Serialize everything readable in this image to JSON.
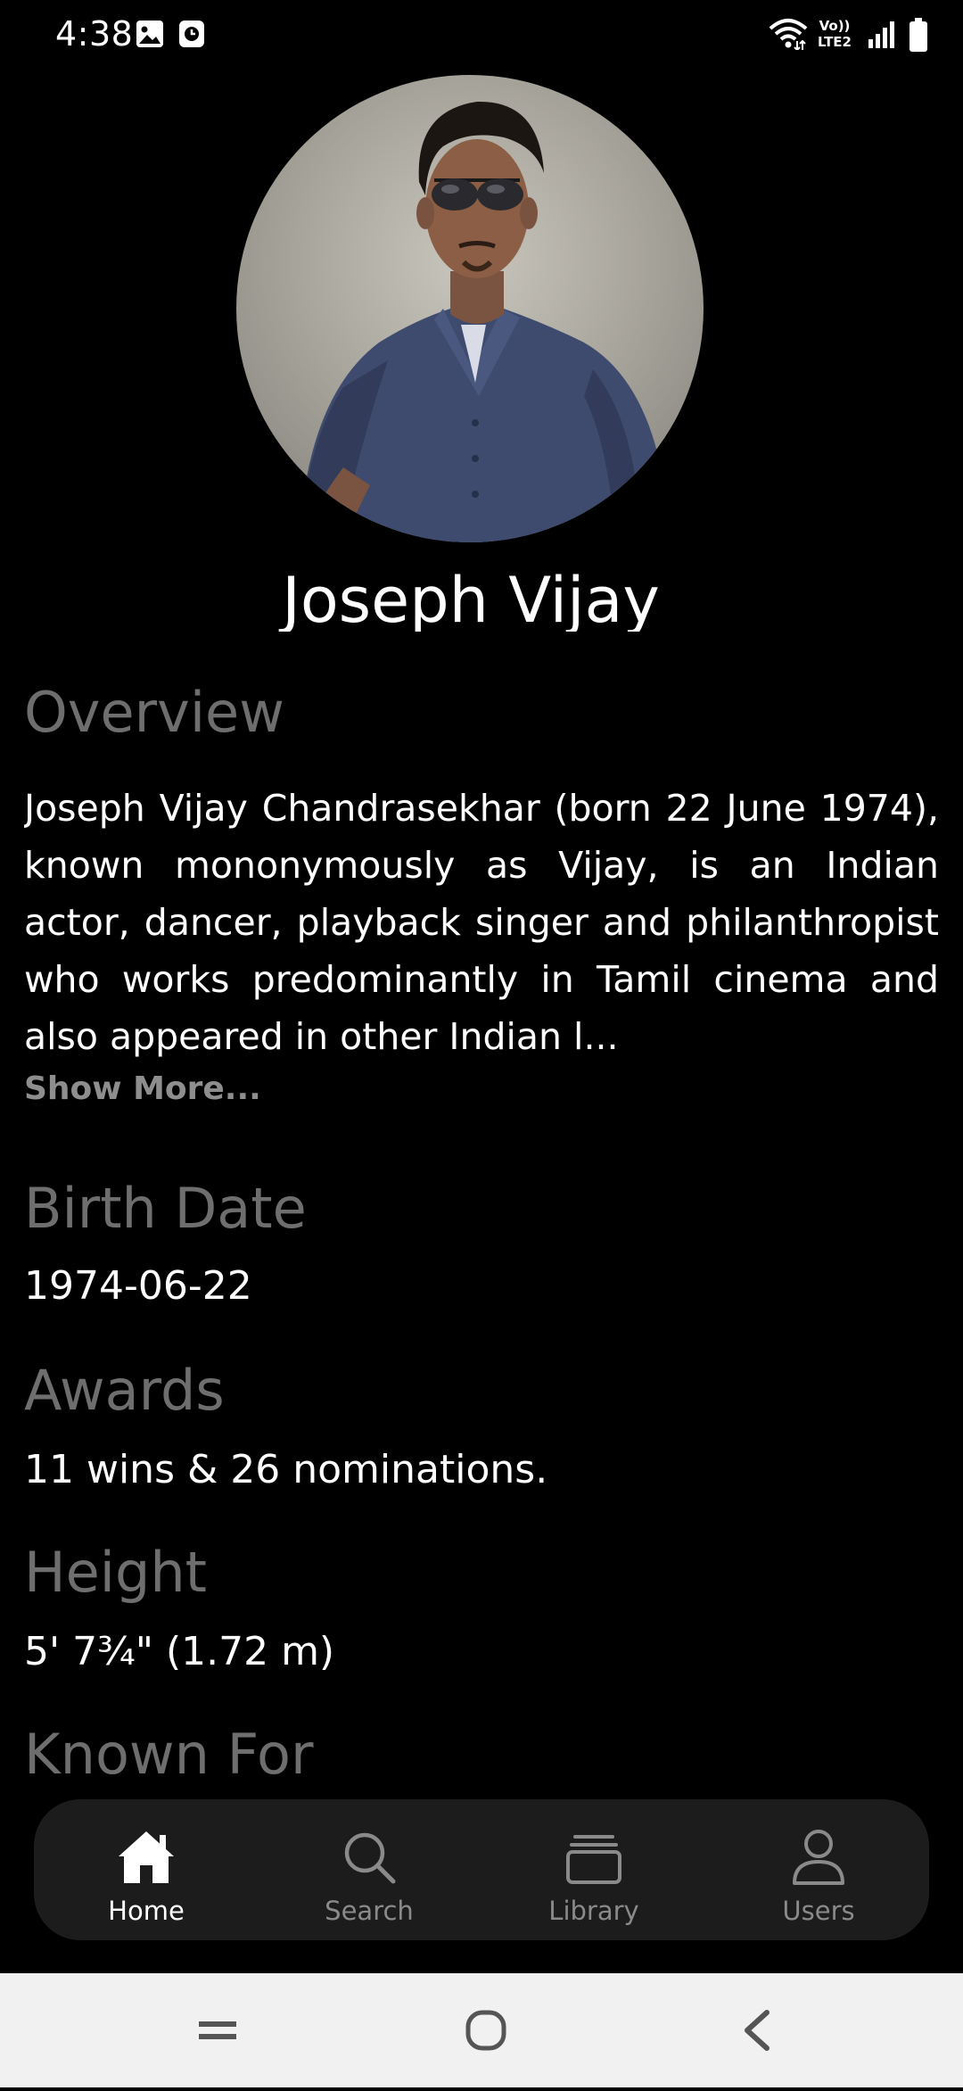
{
  "status_bar": {
    "time": "4:38",
    "icons": [
      "gallery-icon",
      "clock-app-icon",
      "wifi-icon",
      "volte-lte2-icon",
      "signal-icon",
      "battery-icon"
    ],
    "network_label_top": "Vo))",
    "network_label_bottom": "LTE2"
  },
  "profile": {
    "name": "Joseph Vijay"
  },
  "overview": {
    "title": "Overview",
    "text": "Joseph Vijay Chandrasekhar (born 22 June 1974), known mononymously as Vijay, is an Indian actor, dancer, playback singer and philanthropist who works predominantly in Tamil cinema and also appeared in other Indian l...",
    "show_more": "Show More..."
  },
  "birth_date": {
    "title": "Birth Date",
    "value": "1974-06-22"
  },
  "awards": {
    "title": "Awards",
    "value": "11 wins & 26 nominations."
  },
  "height": {
    "title": "Height",
    "value": "5' 7¾\" (1.72 m)"
  },
  "known_for": {
    "title": "Known For"
  },
  "bottom_nav": {
    "items": [
      {
        "label": "Home",
        "icon": "home-icon",
        "active": true
      },
      {
        "label": "Search",
        "icon": "search-icon",
        "active": false
      },
      {
        "label": "Library",
        "icon": "library-icon",
        "active": false
      },
      {
        "label": "Users",
        "icon": "user-icon",
        "active": false
      }
    ]
  },
  "system_nav": {
    "icons": [
      "recents-icon",
      "home-circle-icon",
      "back-icon"
    ]
  },
  "colors": {
    "background": "#000000",
    "section_title": "#6e6e6e",
    "nav_background": "#1c1c1c",
    "nav_inactive": "#8a8a8a",
    "system_nav_background": "#f1f1f1"
  }
}
